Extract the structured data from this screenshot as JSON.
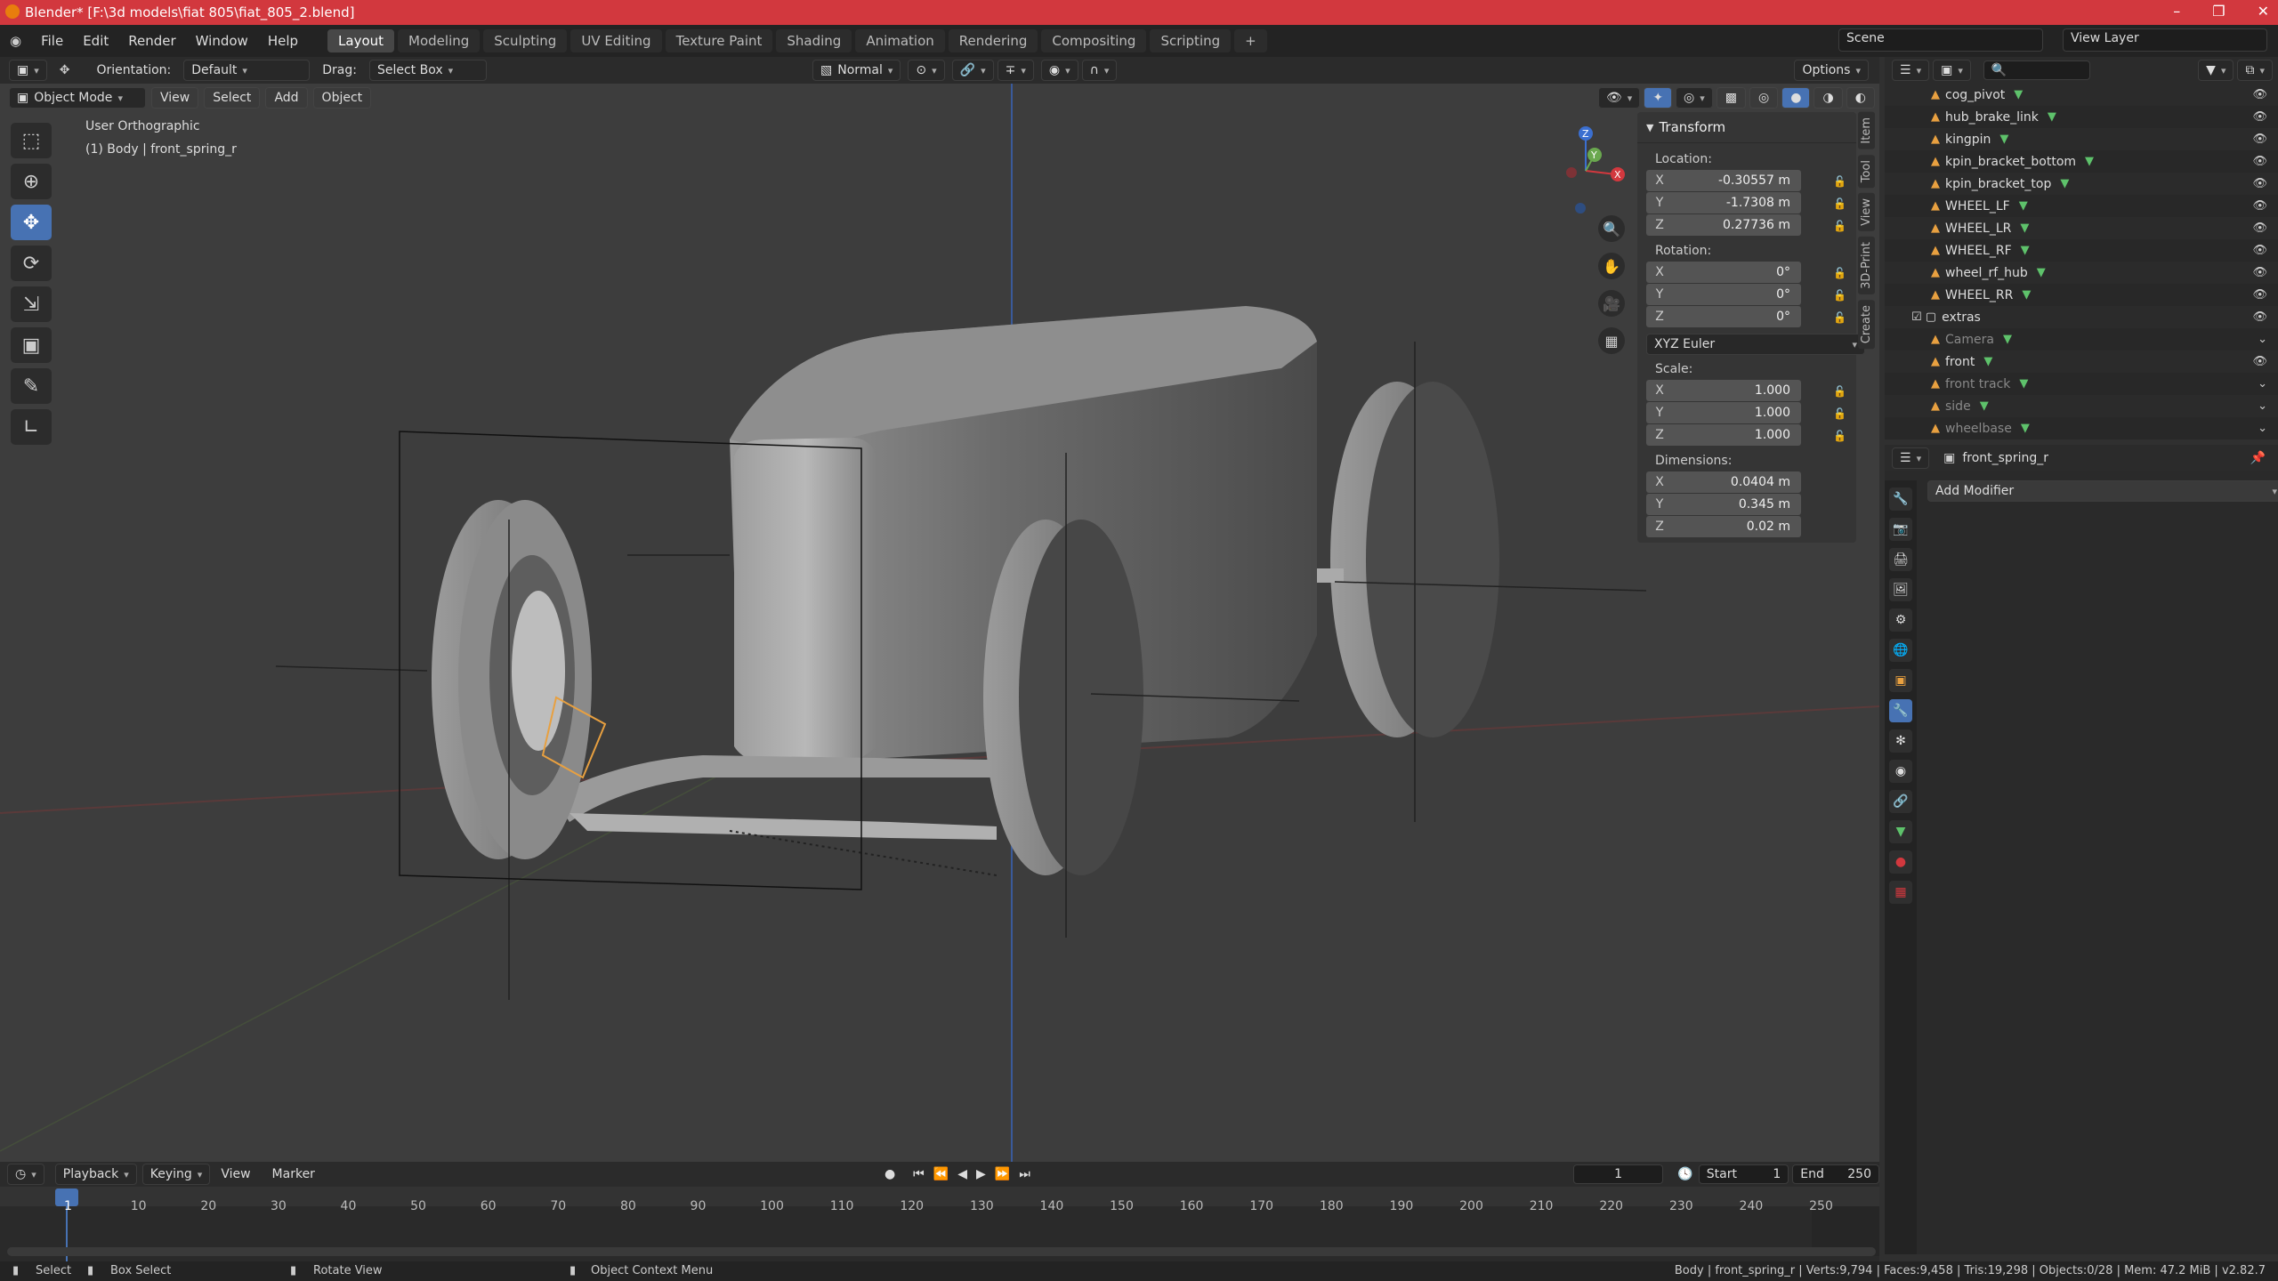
{
  "window": {
    "title": "Blender* [F:\\3d models\\fiat 805\\fiat_805_2.blend]",
    "controls": [
      "–",
      "❐",
      "✕"
    ]
  },
  "menu": {
    "items": [
      "File",
      "Edit",
      "Render",
      "Window",
      "Help"
    ]
  },
  "workspaces": [
    "Layout",
    "Modeling",
    "Sculpting",
    "UV Editing",
    "Texture Paint",
    "Shading",
    "Animation",
    "Rendering",
    "Compositing",
    "Scripting"
  ],
  "workspace_add": "+",
  "scene": {
    "name": "Scene",
    "view_layer": "View Layer"
  },
  "viewport_header": {
    "orientation_label": "Orientation:",
    "orientation_value": "Default",
    "drag_label": "Drag:",
    "drag_value": "Select Box",
    "pivot": "Normal",
    "options": "Options",
    "mode": "Object Mode",
    "menus": [
      "View",
      "Select",
      "Add",
      "Object"
    ]
  },
  "viewport": {
    "view_name": "User Orthographic",
    "object_info": "(1) Body | front_spring_r"
  },
  "transform": {
    "title": "Transform",
    "location_label": "Location:",
    "location": [
      {
        "axis": "X",
        "value": "-0.30557 m"
      },
      {
        "axis": "Y",
        "value": "-1.7308 m"
      },
      {
        "axis": "Z",
        "value": "0.27736 m"
      }
    ],
    "rotation_label": "Rotation:",
    "rotation": [
      {
        "axis": "X",
        "value": "0°"
      },
      {
        "axis": "Y",
        "value": "0°"
      },
      {
        "axis": "Z",
        "value": "0°"
      }
    ],
    "rotation_mode": "XYZ Euler",
    "scale_label": "Scale:",
    "scale": [
      {
        "axis": "X",
        "value": "1.000"
      },
      {
        "axis": "Y",
        "value": "1.000"
      },
      {
        "axis": "Z",
        "value": "1.000"
      }
    ],
    "dimensions_label": "Dimensions:",
    "dimensions": [
      {
        "axis": "X",
        "value": "0.0404 m"
      },
      {
        "axis": "Y",
        "value": "0.345 m"
      },
      {
        "axis": "Z",
        "value": "0.02 m"
      }
    ]
  },
  "sidebar_tabs": [
    "Item",
    "Tool",
    "View",
    "3D-Print",
    "Create"
  ],
  "outliner": {
    "rows": [
      {
        "name": "cog_pivot",
        "dim": false
      },
      {
        "name": "hub_brake_link",
        "dim": false
      },
      {
        "name": "kingpin",
        "dim": false
      },
      {
        "name": "kpin_bracket_bottom",
        "dim": false
      },
      {
        "name": "kpin_bracket_top",
        "dim": false
      },
      {
        "name": "WHEEL_LF",
        "dim": false
      },
      {
        "name": "WHEEL_LR",
        "dim": false
      },
      {
        "name": "WHEEL_RF",
        "dim": false
      },
      {
        "name": "wheel_rf_hub",
        "dim": false
      },
      {
        "name": "WHEEL_RR",
        "dim": false
      },
      {
        "name": "extras",
        "dim": false
      },
      {
        "name": "Camera",
        "dim": true
      },
      {
        "name": "front",
        "dim": false
      },
      {
        "name": "front track",
        "dim": true
      },
      {
        "name": "side",
        "dim": true
      },
      {
        "name": "wheelbase",
        "dim": true
      }
    ]
  },
  "properties": {
    "object_name": "front_spring_r",
    "add_modifier": "Add Modifier"
  },
  "timeline": {
    "menus": [
      "Playback",
      "Keying",
      "View",
      "Marker"
    ],
    "current_frame": "1",
    "start_label": "Start",
    "start": "1",
    "end_label": "End",
    "end": "250",
    "ruler": [
      "1",
      "10",
      "20",
      "30",
      "40",
      "50",
      "60",
      "70",
      "80",
      "90",
      "100",
      "110",
      "120",
      "130",
      "140",
      "150",
      "160",
      "170",
      "180",
      "190",
      "200",
      "210",
      "220",
      "230",
      "240",
      "250"
    ]
  },
  "statusbar": {
    "left": [
      "Select",
      "Box Select",
      "Rotate View",
      "Object Context Menu"
    ],
    "right": "Body | front_spring_r | Verts:9,794 | Faces:9,458 | Tris:19,298 | Objects:0/28 | Mem: 47.2 MiB | v2.82.7"
  },
  "gizmo": {
    "x": "X",
    "y": "Y",
    "z": "Z"
  },
  "colors": {
    "title_bar": "#d2383e",
    "active_tool": "#4772b3",
    "object_orange": "#e8a040",
    "mesh_green": "#5ec26b"
  }
}
